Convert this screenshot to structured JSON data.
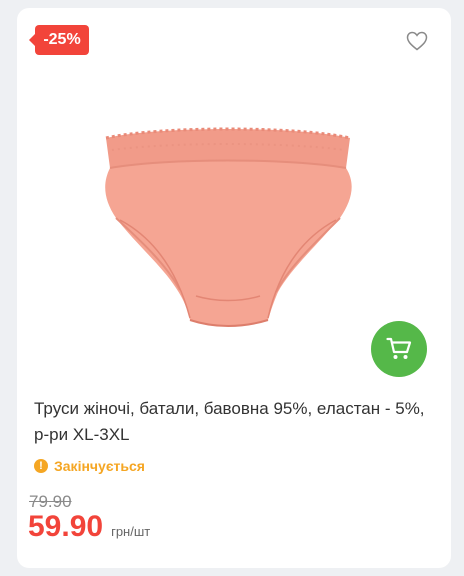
{
  "badge": {
    "discount": "-25%"
  },
  "icons": {
    "favorite": "heart-outline-icon",
    "cart": "cart-icon",
    "warning": "exclamation-icon"
  },
  "product": {
    "image": "womens-briefs-peach-lace",
    "title": "Труси жіночі, батали, бавовна 95%, еластан - 5%, р-ри XL-3XL",
    "stock_icon_glyph": "!",
    "stock_status": "Закінчується",
    "old_price": "79.90",
    "price": "59.90",
    "unit": "грн/шт"
  },
  "colors": {
    "badge": "#f2443a",
    "price": "#f2443a",
    "cart_button": "#55b849",
    "stock_warning": "#f5a623",
    "product": "#f3a08e"
  }
}
